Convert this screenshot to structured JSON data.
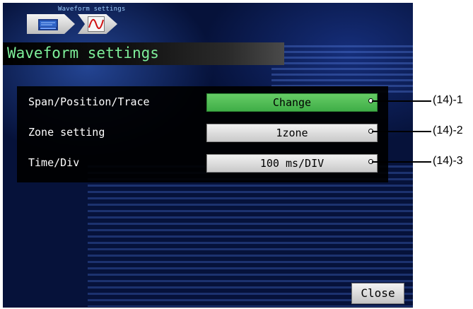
{
  "breadcrumb": {
    "label": "Waveform settings",
    "items": [
      {
        "icon": "display-icon"
      },
      {
        "icon": "waveform-icon"
      }
    ]
  },
  "title": "Waveform settings",
  "settings": [
    {
      "label": "Span/Position/Trace",
      "value": "Change",
      "highlight": true,
      "callout": "(14)-1"
    },
    {
      "label": "Zone setting",
      "value": "1zone",
      "highlight": false,
      "callout": "(14)-2"
    },
    {
      "label": "Time/Div",
      "value": "100 ms/DIV",
      "highlight": false,
      "callout": "(14)-3"
    }
  ],
  "close_label": "Close",
  "colors": {
    "screen_bg": "#06123a",
    "title_text": "#7ef09a",
    "highlight_button": "#4fbf55",
    "button": "#dcdcdc"
  }
}
